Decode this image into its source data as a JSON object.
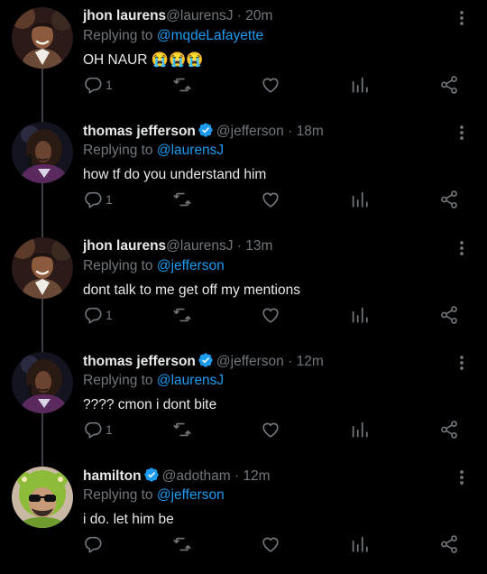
{
  "tweets": [
    {
      "name": "jhon laurens",
      "handle": "@laurensJ",
      "time": "20m",
      "verified": false,
      "replying_label": "Replying to",
      "replying_to": "@mqdeLafayette",
      "text": "OH NAUR",
      "emoji": "😭😭😭",
      "reply_count": "1",
      "avatar": "laurens"
    },
    {
      "name": "thomas jefferson",
      "handle": "@jefferson",
      "time": "18m",
      "verified": true,
      "replying_label": "Replying to",
      "replying_to": "@laurensJ",
      "text": "how tf do you understand him",
      "emoji": "",
      "reply_count": "1",
      "avatar": "jefferson"
    },
    {
      "name": "jhon laurens",
      "handle": "@laurensJ",
      "time": "13m",
      "verified": false,
      "replying_label": "Replying to",
      "replying_to": "@jefferson",
      "text": "dont talk to me get off my mentions",
      "emoji": "",
      "reply_count": "1",
      "avatar": "laurens"
    },
    {
      "name": "thomas jefferson",
      "handle": "@jefferson",
      "time": "12m",
      "verified": true,
      "replying_label": "Replying to",
      "replying_to": "@laurensJ",
      "text": "???? cmon i dont bite",
      "emoji": "",
      "reply_count": "1",
      "avatar": "jefferson"
    },
    {
      "name": "hamilton",
      "handle": "@adotham",
      "time": "12m",
      "verified": true,
      "replying_label": "Replying to",
      "replying_to": "@jefferson",
      "text": "i do. let him be",
      "emoji": "",
      "reply_count": "",
      "avatar": "hamilton"
    }
  ],
  "colors": {
    "background": "#000000",
    "text": "#e7e9ea",
    "muted": "#71767b",
    "accent": "#1d9bf0"
  },
  "icons": [
    "reply-icon",
    "retweet-icon",
    "like-icon",
    "analytics-icon",
    "share-icon",
    "more-icon",
    "verified-icon"
  ]
}
